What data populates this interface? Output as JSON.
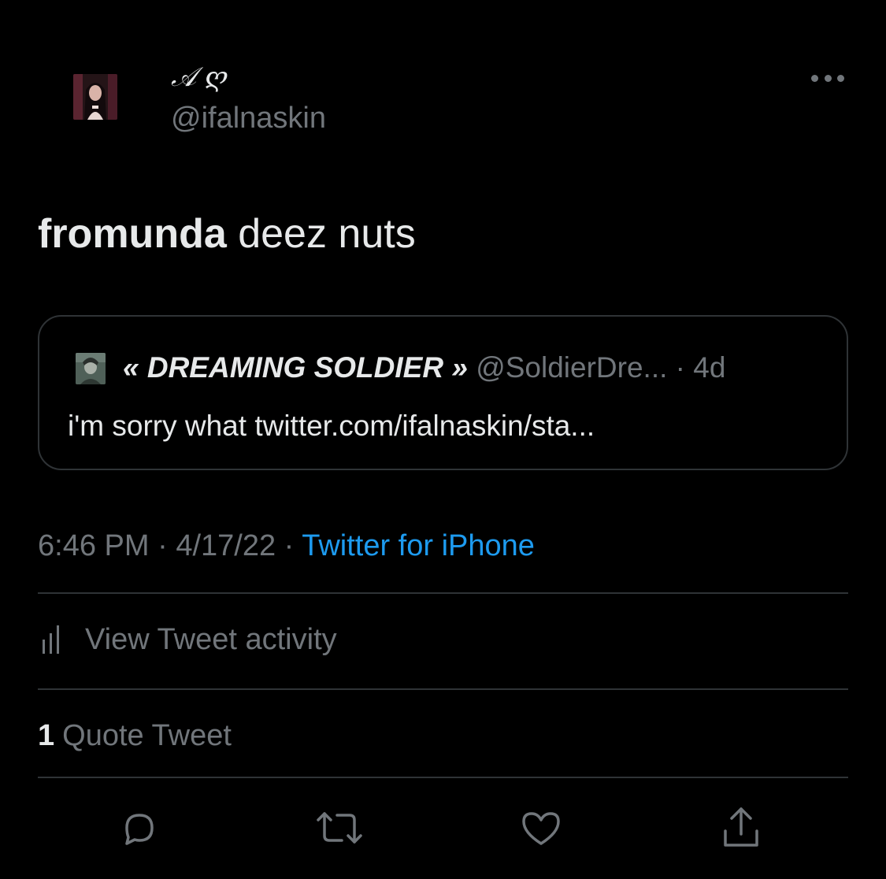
{
  "author": {
    "display_name": "𝒜 ღ",
    "handle": "@ifalnaskin",
    "avatar_icon": "profile-photo"
  },
  "tweet": {
    "text_bold": "fromunda",
    "text_rest": " deez nuts"
  },
  "quoted_tweet": {
    "name": "« DREAMING SOLDIER »",
    "handle": "@SoldierDre...",
    "separator": " · ",
    "age": "4d",
    "text": "i'm sorry what twitter.com/ifalnaskin/sta..."
  },
  "meta": {
    "time": "6:46 PM",
    "date": "4/17/22",
    "separator": " · ",
    "source": "Twitter for iPhone"
  },
  "activity": {
    "label": "View Tweet activity",
    "icon": "bar-chart-icon"
  },
  "stats": {
    "quote_count": "1",
    "quote_label": "Quote Tweet"
  },
  "actions": [
    {
      "name": "reply",
      "icon": "reply-icon"
    },
    {
      "name": "retweet",
      "icon": "retweet-icon"
    },
    {
      "name": "like",
      "icon": "heart-icon"
    },
    {
      "name": "share",
      "icon": "share-icon"
    }
  ],
  "colors": {
    "background": "#000000",
    "text_primary": "#e7e9ea",
    "text_secondary": "#71767b",
    "link": "#1d9bf0",
    "border": "#2f3336"
  }
}
